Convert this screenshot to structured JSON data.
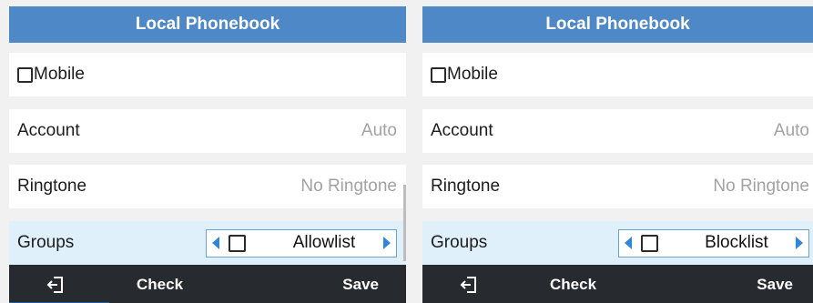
{
  "screens": [
    {
      "title": "Local Phonebook",
      "mobile_label": "Mobile",
      "account_label": "Account",
      "account_value": "Auto",
      "ringtone_label": "Ringtone",
      "ringtone_value": "No Ringtone",
      "groups_label": "Groups",
      "groups_value": "Allowlist",
      "softkeys": {
        "check": "Check",
        "save": "Save",
        "exit_icon": "exit-icon"
      }
    },
    {
      "title": "Local Phonebook",
      "mobile_label": "Mobile",
      "account_label": "Account",
      "account_value": "Auto",
      "ringtone_label": "Ringtone",
      "ringtone_value": "No Ringtone",
      "groups_label": "Groups",
      "groups_value": "Blocklist",
      "softkeys": {
        "check": "Check",
        "save": "Save",
        "exit_icon": "exit-icon"
      }
    }
  ],
  "colors": {
    "title_bar": "#4f88c6",
    "selected_row": "#dff0fb",
    "softkey_bar": "#272b30",
    "accent_arrow": "#2f86d8"
  }
}
